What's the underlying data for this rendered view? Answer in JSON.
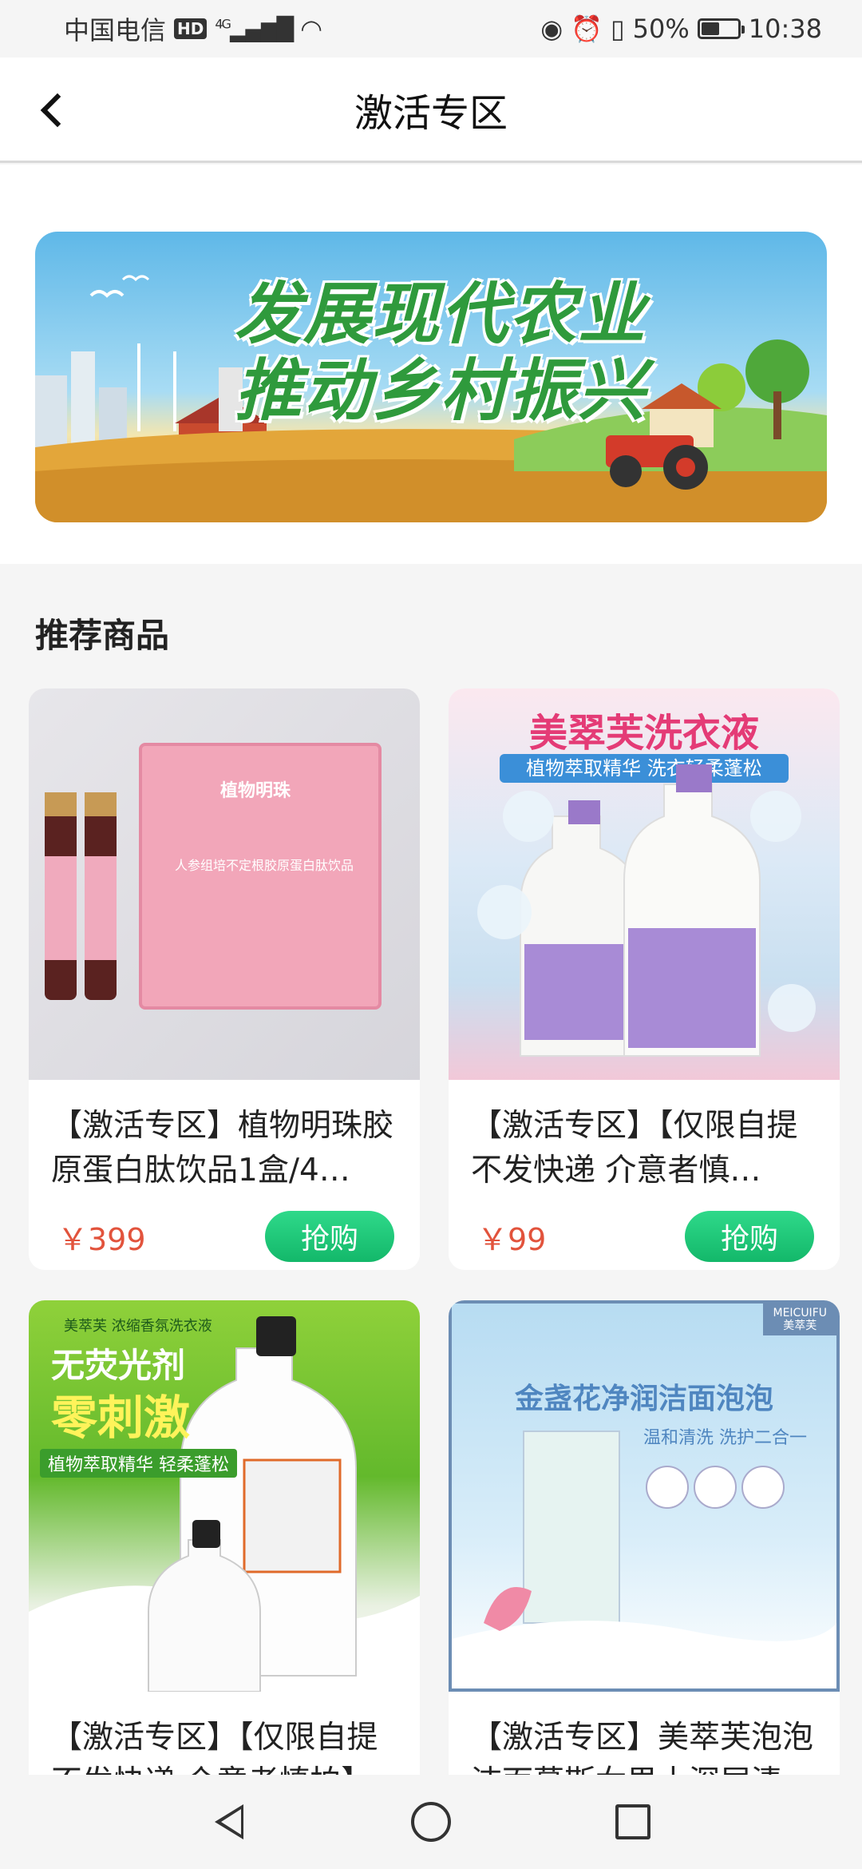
{
  "status_bar": {
    "carrier": "中国电信",
    "hd": "HD",
    "network": "4G",
    "battery": "50%",
    "time": "10:38"
  },
  "header": {
    "title": "激活专区"
  },
  "banner": {
    "line1": "发展现代农业",
    "line2": "推动乡村振兴"
  },
  "section": {
    "title": "推荐商品"
  },
  "products": [
    {
      "name": "【激活专区】植物明珠胶原蛋白肽饮品1盒/4…",
      "price": "￥399",
      "buy_label": "抢购",
      "image": {
        "brand": "植物明珠",
        "desc": "人参组培不定根胶原蛋白肽饮品"
      }
    },
    {
      "name": "【激活专区】【仅限自提不发快递 介意者慎拍】…",
      "price": "￥99",
      "buy_label": "抢购",
      "image": {
        "title": "美翠芙洗衣液",
        "sub": "植物萃取精华  洗衣轻柔蓬松"
      }
    },
    {
      "name": "【激活专区】【仅限自提不发快递 介意者慎拍】",
      "image": {
        "top": "美萃芙 浓缩香氛洗衣液",
        "line1": "无荧光剂",
        "line2": "零刺激",
        "tag": "植物萃取精华 轻柔蓬松"
      }
    },
    {
      "name": "【激活专区】美萃芙泡泡洁面慕斯女男士深层清",
      "image": {
        "logo": "MEICUIFU",
        "logo_cn": "美萃芙",
        "title": "金盏花净润洁面泡泡",
        "sub": "温和清洗 洗护二合一"
      }
    }
  ],
  "colors": {
    "accent_green": "#1fc27a",
    "price_red": "#e2533c"
  }
}
